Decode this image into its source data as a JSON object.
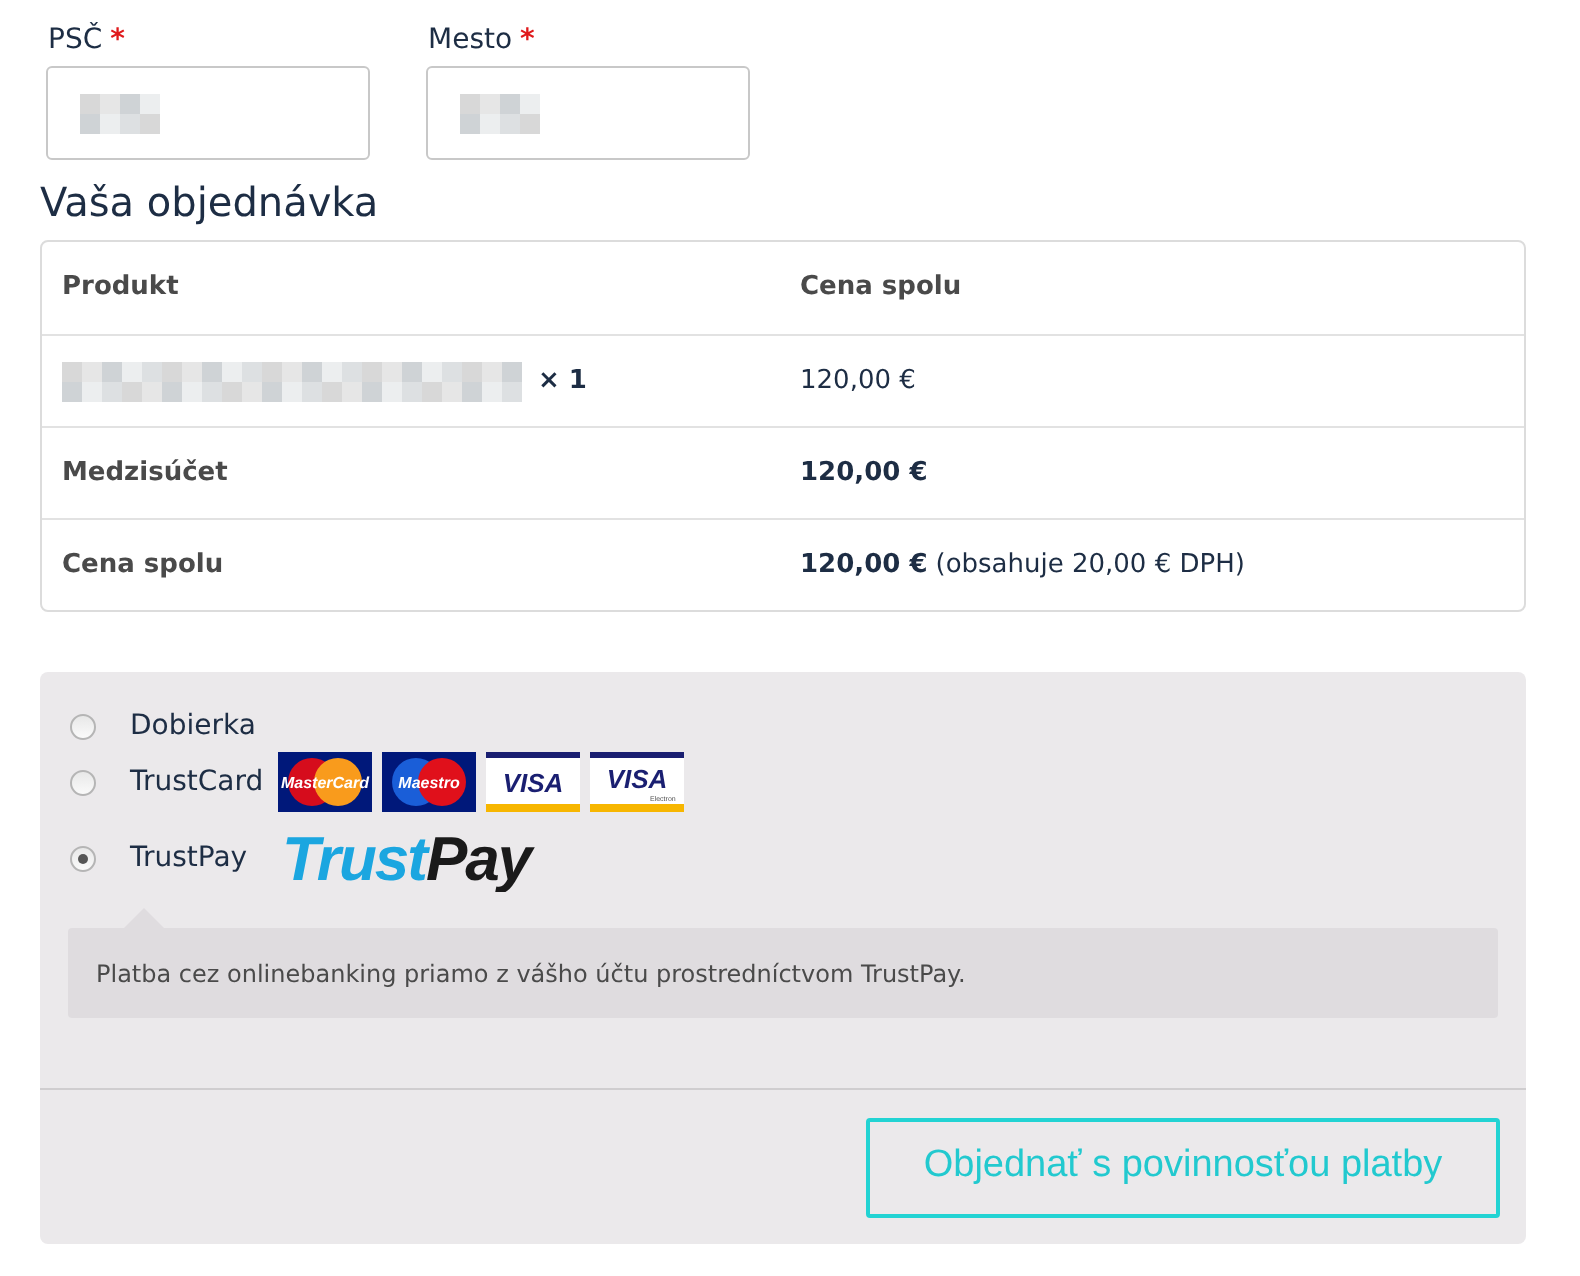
{
  "fields": [
    {
      "label": "PSČ",
      "required": "*",
      "value_redacted": true
    },
    {
      "label": "Mesto",
      "required": "*",
      "value_redacted": true
    }
  ],
  "order": {
    "title": "Vaša objednávka",
    "columns": [
      "Produkt",
      "Cena spolu"
    ],
    "items": [
      {
        "name_redacted": true,
        "quantity": "× 1",
        "price": "120,00 €"
      }
    ],
    "totals": [
      {
        "label": "Medzisúčet",
        "amount": "120,00 €"
      },
      {
        "label": "Cena spolu",
        "amount": "120,00 €",
        "note": "(obsahuje 20,00 € DPH)"
      }
    ]
  },
  "payment_methods": [
    {
      "label": "Dobierka",
      "selected": false
    },
    {
      "label": "TrustCard",
      "selected": false,
      "logos": [
        {
          "kind": "mastercard",
          "text": "MasterCard"
        },
        {
          "kind": "maestro",
          "text": "Maestro"
        },
        {
          "kind": "visa",
          "text": "VISA"
        },
        {
          "kind": "visa-electron",
          "text": "VISA",
          "subtext": "Electron"
        }
      ]
    },
    {
      "label": "TrustPay",
      "selected": true,
      "logos": [
        {
          "kind": "trustpay",
          "text": "Trust",
          "text2": "Pay"
        }
      ],
      "description": "Platba cez onlinebanking priamo z vášho účtu prostredníctvom TrustPay."
    }
  ],
  "submit_button": "Objednať s povinnosťou platby"
}
